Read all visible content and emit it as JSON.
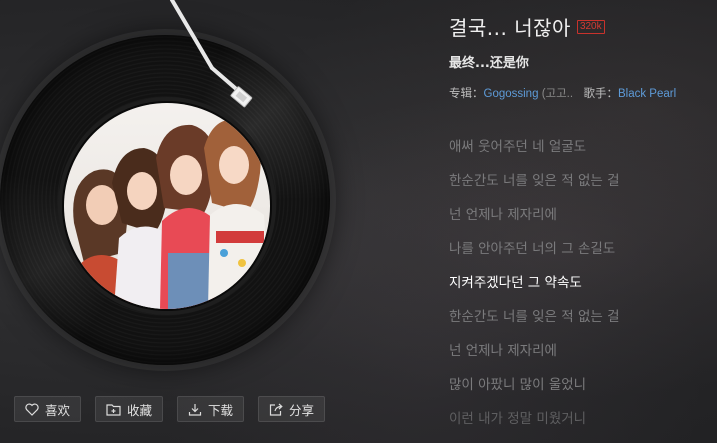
{
  "song": {
    "title": "결국... 너잖아",
    "quality_badge": "320k",
    "subtitle": "最终...还是你"
  },
  "meta": {
    "album_label": "专辑：",
    "album_name": "Gogossing",
    "album_extra": "(고고..",
    "artist_label": "歌手：",
    "artist_name": "Black Pearl"
  },
  "lyrics": [
    "애써 웃어주던 네 얼굴도",
    "한순간도 너를 잊은 적 없는 걸",
    "넌 언제나 제자리에",
    "나를 안아주던 너의 그 손길도",
    "지켜주겠다던 그 약속도",
    "한순간도 너를 잊은 적 없는 걸",
    "넌 언제나 제자리에",
    "많이 아팠니 많이 울었니",
    "이런 내가 정말 미웠거니"
  ],
  "active_lyric_index": 4,
  "actions": {
    "like": "喜欢",
    "collect": "收藏",
    "download": "下载",
    "share": "分享"
  },
  "colors": {
    "accent_link": "#5e9bd8",
    "badge": "#d43a32",
    "active_lyric": "#ffffff",
    "inactive_lyric": "#7b7b7d"
  },
  "icons": {
    "like": "heart-icon",
    "collect": "folder-plus-icon",
    "download": "download-icon",
    "share": "share-icon"
  }
}
